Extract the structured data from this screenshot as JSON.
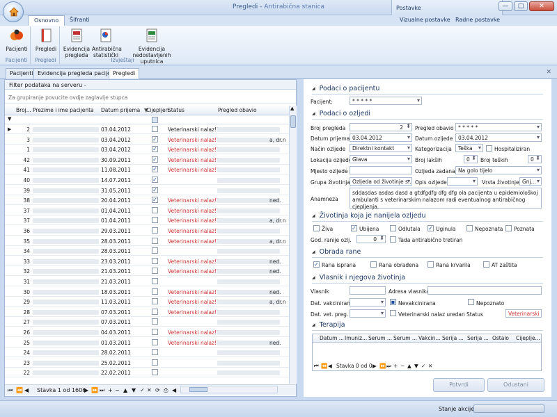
{
  "window": {
    "title_part1": "Pregledi",
    "title_sep": " - ",
    "title_part2": "Antirabična stanica",
    "postavke_label": "Postavke",
    "controls": {
      "minimize": "—",
      "maximize": "□",
      "close": "✕"
    }
  },
  "ribbon": {
    "tabs": [
      "Osnovno",
      "Šifranti"
    ],
    "active_tab": "Osnovno",
    "right_tabs": [
      "Vizualne postavke",
      "Radne postavke"
    ],
    "groups": [
      {
        "label": "Pacijenti",
        "buttons": [
          {
            "label": "Pacijenti",
            "icon": "patients-icon"
          }
        ]
      },
      {
        "label": "Pregledi",
        "buttons": [
          {
            "label": "Pregledi",
            "icon": "document-icon"
          }
        ]
      },
      {
        "label": "Izvještaji",
        "buttons": [
          {
            "label": "Evidencija\npregleda",
            "icon": "report-pdf-icon"
          },
          {
            "label": "Antirabična\nstatistički",
            "icon": "stats-icon"
          },
          {
            "label": "Evidencija\nnedostavljenih uputnica",
            "icon": "excel-report-icon"
          }
        ]
      }
    ]
  },
  "doc_tabs": [
    "Pacijenti",
    "Evidencija pregleda pacijenata",
    "Pregledi"
  ],
  "active_doc_tab": "Pregledi",
  "grid": {
    "filter_label": "Filter podataka na serveru -",
    "group_hint": "Za grupiranje povucite ovdje zaglavlje stupca",
    "columns": [
      "Broj...",
      "Prezime i ime pacijenta",
      "Datum prijema",
      "Cijepljen",
      "Status",
      "Pregled obavio"
    ],
    "rows": [
      {
        "broj": "2",
        "date": "03.04.2012",
        "cijepljen": false,
        "status": "Veterinarski nalaz!?",
        "status_red": false,
        "tail": "",
        "selected": true
      },
      {
        "broj": "3",
        "date": "03.04.2012",
        "cijepljen": true,
        "status": "Veterinarski nalaz!?",
        "status_red": true,
        "tail": "a, dr.n"
      },
      {
        "broj": "1",
        "date": "03.04.2012",
        "cijepljen": true,
        "status": "Veterinarski nalaz!?",
        "status_red": true,
        "tail": ""
      },
      {
        "broj": "42",
        "date": "30.09.2011",
        "cijepljen": true,
        "status": "Veterinarski nalaz!?",
        "status_red": true,
        "tail": ""
      },
      {
        "broj": "41",
        "date": "11.08.2011",
        "cijepljen": true,
        "status": "Veterinarski nalaz!?",
        "status_red": true,
        "tail": ""
      },
      {
        "broj": "40",
        "date": "14.07.2011",
        "cijepljen": true,
        "status": "",
        "status_red": true,
        "tail": ""
      },
      {
        "broj": "39",
        "date": "31.05.2011",
        "cijepljen": true,
        "status": "",
        "status_red": true,
        "tail": ""
      },
      {
        "broj": "38",
        "date": "20.04.2011",
        "cijepljen": true,
        "status": "Veterinarski nalaz!?",
        "status_red": true,
        "tail": "ned."
      },
      {
        "broj": "37",
        "date": "01.04.2011",
        "cijepljen": false,
        "status": "Veterinarski nalaz!?",
        "status_red": true,
        "tail": ""
      },
      {
        "broj": "37",
        "date": "01.04.2011",
        "cijepljen": false,
        "status": "Veterinarski nalaz!?",
        "status_red": true,
        "tail": "a, dr.n"
      },
      {
        "broj": "36",
        "date": "29.03.2011",
        "cijepljen": false,
        "status": "Veterinarski nalaz!?",
        "status_red": true,
        "tail": ""
      },
      {
        "broj": "35",
        "date": "28.03.2011",
        "cijepljen": false,
        "status": "Veterinarski nalaz!?",
        "status_red": true,
        "tail": "a, dr.n"
      },
      {
        "broj": "34",
        "date": "28.03.2011",
        "cijepljen": false,
        "status": "",
        "status_red": true,
        "tail": ""
      },
      {
        "broj": "33",
        "date": "23.03.2011",
        "cijepljen": false,
        "status": "Veterinarski nalaz!?",
        "status_red": true,
        "tail": "ned."
      },
      {
        "broj": "32",
        "date": "21.03.2011",
        "cijepljen": false,
        "status": "Veterinarski nalaz!?",
        "status_red": true,
        "tail": "ned."
      },
      {
        "broj": "31",
        "date": "21.03.2011",
        "cijepljen": false,
        "status": "",
        "status_red": true,
        "tail": ""
      },
      {
        "broj": "30",
        "date": "18.03.2011",
        "cijepljen": false,
        "status": "Veterinarski nalaz!?",
        "status_red": true,
        "tail": "ned."
      },
      {
        "broj": "29",
        "date": "11.03.2011",
        "cijepljen": false,
        "status": "Veterinarski nalaz!?",
        "status_red": true,
        "tail": "a, dr.n"
      },
      {
        "broj": "28",
        "date": "07.03.2011",
        "cijepljen": false,
        "status": "Veterinarski nalaz!?",
        "status_red": true,
        "tail": ""
      },
      {
        "broj": "27",
        "date": "07.03.2011",
        "cijepljen": false,
        "status": "",
        "status_red": true,
        "tail": ""
      },
      {
        "broj": "26",
        "date": "04.03.2011",
        "cijepljen": false,
        "status": "Veterinarski nalaz!?",
        "status_red": true,
        "tail": ""
      },
      {
        "broj": "25",
        "date": "01.03.2011",
        "cijepljen": false,
        "status": "Veterinarski nalaz!?",
        "status_red": true,
        "tail": "ned."
      },
      {
        "broj": "24",
        "date": "28.02.2011",
        "cijepljen": false,
        "status": "",
        "status_red": true,
        "tail": ""
      },
      {
        "broj": "23",
        "date": "25.02.2011",
        "cijepljen": false,
        "status": "",
        "status_red": true,
        "tail": ""
      },
      {
        "broj": "22",
        "date": "22.02.2011",
        "cijepljen": false,
        "status": "",
        "status_red": true,
        "tail": ""
      }
    ],
    "pager_text": "Stavka 1 od 1606"
  },
  "form": {
    "sec_pacijent": "Podaci o pacijentu",
    "pacijent_label": "Pacijent:",
    "pacijent_value": "* * * * *",
    "sec_ozljeda": "Podaci o ozljedi",
    "broj_pregleda_label": "Broj pregleda",
    "broj_pregleda": "2",
    "pregled_obavio_label": "Pregled obavio",
    "pregled_obavio": "* * * * *",
    "datum_prijema_label": "Datum prijema",
    "datum_prijema": "03.04.2012",
    "datum_ozljede_label": "Datum ozljede",
    "datum_ozljede": "03.04.2012",
    "nacin_label": "Način ozljede",
    "nacin": "Direktni kontakt",
    "kategorizacija_label": "Kategorizacija",
    "kategorizacija": "Teška",
    "hospitaliziran_label": "Hospitaliziran",
    "lokacija_label": "Lokacija ozljede",
    "lokacija": "Glava",
    "broj_laksih_label": "Broj lakših",
    "broj_laksih": "0",
    "broj_teskih_label": "Broj teških",
    "broj_teskih": "0",
    "mjesto_label": "Mjesto ozljede",
    "ozljeda_zadana_label": "Ozljeda zadana",
    "ozljeda_zadana": "Na golo tijelo",
    "grupa_label": "Grupa životinja",
    "grupa": "Ozljeda od životinje s...",
    "opis_label": "Opis ozljede",
    "vrsta_label": "Vrsta životinje",
    "vrsta": "Gnj...",
    "anamneza_label": "Anamneza",
    "anamneza": "sddasdas asdas dasd a gtdfgdfg dfg dfg  ola pacijenta  u epidemiološkoj ambulanti s veterinarskim nalazom radi eventualnog antirabičnog cjepljenja.",
    "sec_zivotinja": "Životinja koja je nanijela ozljedu",
    "ziva": "Živa",
    "ubijena": "Ubijena",
    "odlutala": "Odlutala",
    "uginula": "Uginula",
    "nepoznata": "Nepoznata",
    "poznata": "Poznata",
    "god_label": "God. ranije ozlj.",
    "god_value": "0",
    "tada_label": "Tada antirabično tretiran",
    "sec_obrada": "Obrada rane",
    "isprana": "Rana isprana",
    "obradena": "Rana obrađena",
    "krvarila": "Rana krvarila",
    "at_zastita": "AT zaštita",
    "sec_vlasnik": "Vlasnik i njegova životinja",
    "vlasnik_label": "Vlasnik",
    "adresa_label": "Adresa vlasnika",
    "vakcin_label": "Dat. vakciniranja",
    "nevakcinirana": "Nevakcinirana",
    "nepoznato": "Nepoznato",
    "vet_label": "Dat. vet. preg.",
    "vet_uredan": "Veterinarski nalaz uredan",
    "status_label": "Status",
    "status_value": "Veterinarski nal",
    "sec_terapija": "Terapija",
    "terapija_cols": [
      "Datum ...",
      "Imuniz...",
      "Serum ...",
      "Serum ...",
      "Vakcin...",
      "Serija ...",
      "Serija ...",
      "Ostalo",
      "Cijeplje..."
    ],
    "terapija_pager": "Stavka 0 od 0",
    "potvrdi": "Potvrdi",
    "odustani": "Odustani"
  },
  "status_bar": {
    "label": "Stanje akcije:"
  }
}
